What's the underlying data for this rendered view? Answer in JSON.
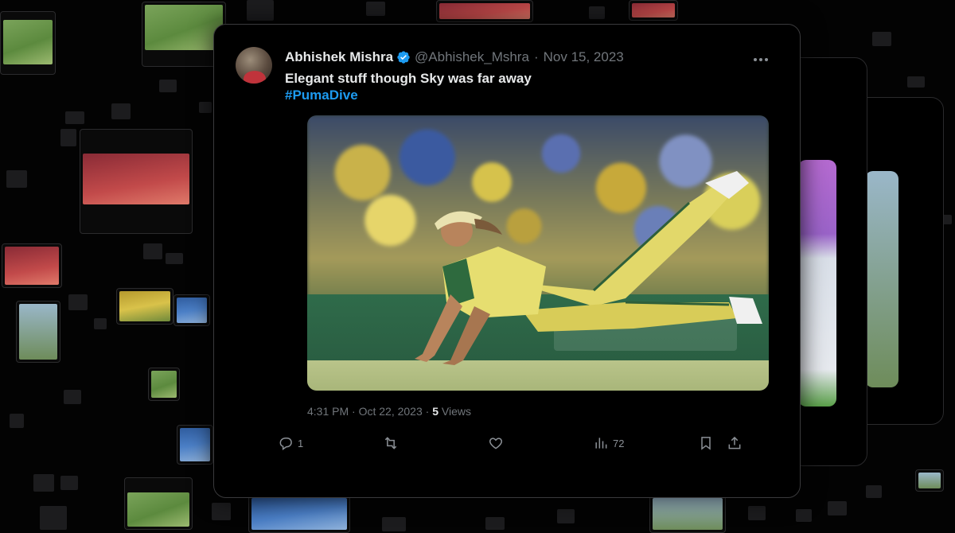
{
  "tweet": {
    "author_name": "Abhishek Mishra",
    "handle": "@Abhishek_Mshra",
    "separator": "·",
    "date": "Nov 15, 2023",
    "text": "Elegant stuff though Sky was far away",
    "hashtag": "#PumaDive",
    "time": "4:31 PM",
    "post_date": "Oct 22, 2023",
    "views_count": "5",
    "views_label": "Views",
    "media_description_icon": "cricket-fielder-diving-photo"
  },
  "actions": {
    "replies": "1",
    "reposts": "",
    "likes": "",
    "views": "72"
  },
  "colors": {
    "background": "#030303",
    "card": "#000000",
    "text": "#e7e9ea",
    "muted": "#71767b",
    "link": "#1d9bf0",
    "verified": "#1d9bf0"
  },
  "icons": [
    "verified-badge-icon",
    "more-icon",
    "reply-icon",
    "repost-icon",
    "like-icon",
    "views-icon",
    "bookmark-icon",
    "share-icon"
  ]
}
